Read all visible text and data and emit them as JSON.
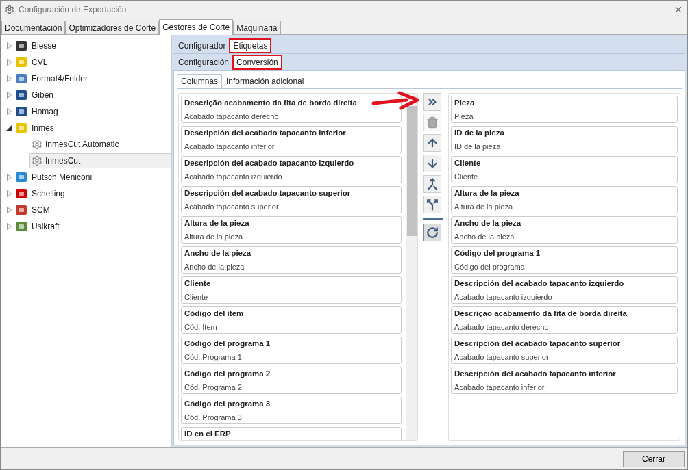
{
  "window": {
    "title": "Configuración de Exportación"
  },
  "tabs": [
    {
      "label": "Documentación",
      "selected": false
    },
    {
      "label": "Optimizadores de Corte",
      "selected": false
    },
    {
      "label": "Gestores de Corte",
      "selected": true
    },
    {
      "label": "Maquinaria",
      "selected": false
    }
  ],
  "tree": [
    {
      "label": "Biesse",
      "expanded": false,
      "selected": false
    },
    {
      "label": "CVL",
      "expanded": false,
      "selected": false
    },
    {
      "label": "Format4/Felder",
      "expanded": false,
      "selected": false
    },
    {
      "label": "Giben",
      "expanded": false,
      "selected": false
    },
    {
      "label": "Homag",
      "expanded": false,
      "selected": false
    },
    {
      "label": "Inmes",
      "expanded": true,
      "selected": false,
      "children": [
        {
          "label": "InmesCut Automatic",
          "selected": false
        },
        {
          "label": "InmesCut",
          "selected": true
        }
      ]
    },
    {
      "label": "Putsch Meniconi",
      "expanded": false,
      "selected": false
    },
    {
      "label": "Schelling",
      "expanded": false,
      "selected": false
    },
    {
      "label": "SCM",
      "expanded": false,
      "selected": false
    },
    {
      "label": "Usikraft",
      "expanded": false,
      "selected": false
    }
  ],
  "sub_tabs": [
    {
      "label": "Configurador",
      "selected": false,
      "highlighted": false
    },
    {
      "label": "Etiquetas",
      "selected": true,
      "highlighted": true
    }
  ],
  "sub_sub_tabs": [
    {
      "label": "Configuración",
      "selected": false,
      "highlighted": false
    },
    {
      "label": "Conversión",
      "selected": true,
      "highlighted": true
    }
  ],
  "inner_tabs": [
    {
      "label": "Columnas",
      "selected": true
    },
    {
      "label": "Información adicional",
      "selected": false
    }
  ],
  "available_columns": [
    {
      "title": "Descrição acabamento da fita de borda direita",
      "subtitle": "Acabado tapacanto derecho"
    },
    {
      "title": "Descripción del acabado tapacanto inferior",
      "subtitle": "Acabado tapacanto inferior"
    },
    {
      "title": "Descripción del acabado tapacanto izquierdo",
      "subtitle": "Acabado tapacanto izquierdo"
    },
    {
      "title": "Descripción del acabado tapacanto superior",
      "subtitle": "Acabado tapacanto superior"
    },
    {
      "title": "Altura de la pieza",
      "subtitle": "Altura de la pieza"
    },
    {
      "title": "Ancho de la pieza",
      "subtitle": "Ancho de la pieza"
    },
    {
      "title": "Cliente",
      "subtitle": "Cliente"
    },
    {
      "title": "Código del ítem",
      "subtitle": "Cód. Ítem"
    },
    {
      "title": "Código del programa 1",
      "subtitle": "Cód. Programa 1"
    },
    {
      "title": "Código del programa 2",
      "subtitle": "Cód. Programa 2"
    },
    {
      "title": "Código del programa 3",
      "subtitle": "Cód. Programa 3"
    },
    {
      "title": "ID en el ERP"
    }
  ],
  "tool_buttons": [
    {
      "kind": "add-all",
      "disabled": false
    },
    {
      "kind": "delete",
      "disabled": true
    },
    {
      "kind": "up",
      "disabled": false
    },
    {
      "kind": "down",
      "disabled": false
    },
    {
      "kind": "merge",
      "disabled": false
    },
    {
      "kind": "split",
      "disabled": false
    },
    {
      "kind": "separator"
    },
    {
      "kind": "refresh",
      "disabled": false
    }
  ],
  "selected_columns": [
    {
      "title": "Pieza",
      "subtitle": "Pieza"
    },
    {
      "title": "ID de la pieza",
      "subtitle": "ID de la pieza"
    },
    {
      "title": "Cliente",
      "subtitle": "Cliente"
    },
    {
      "title": "Altura de la pieza",
      "subtitle": "Altura de la pieza"
    },
    {
      "title": "Ancho de la pieza",
      "subtitle": "Ancho de la pieza"
    },
    {
      "title": "Código del programa 1",
      "subtitle": "Código del programa"
    },
    {
      "title": "Descripción del acabado tapacanto izquierdo",
      "subtitle": "Acabado tapacanto izquierdo"
    },
    {
      "title": "Descrição acabamento da fita de borda direita",
      "subtitle": "Acabado tapacanto derecho"
    },
    {
      "title": "Descripción del acabado tapacanto superior",
      "subtitle": "Acabado tapacanto superior"
    },
    {
      "title": "Descripción del acabado tapacanto inferior",
      "subtitle": "Acabado tapacanto inferior"
    }
  ],
  "footer": {
    "close_button": "Cerrar"
  }
}
